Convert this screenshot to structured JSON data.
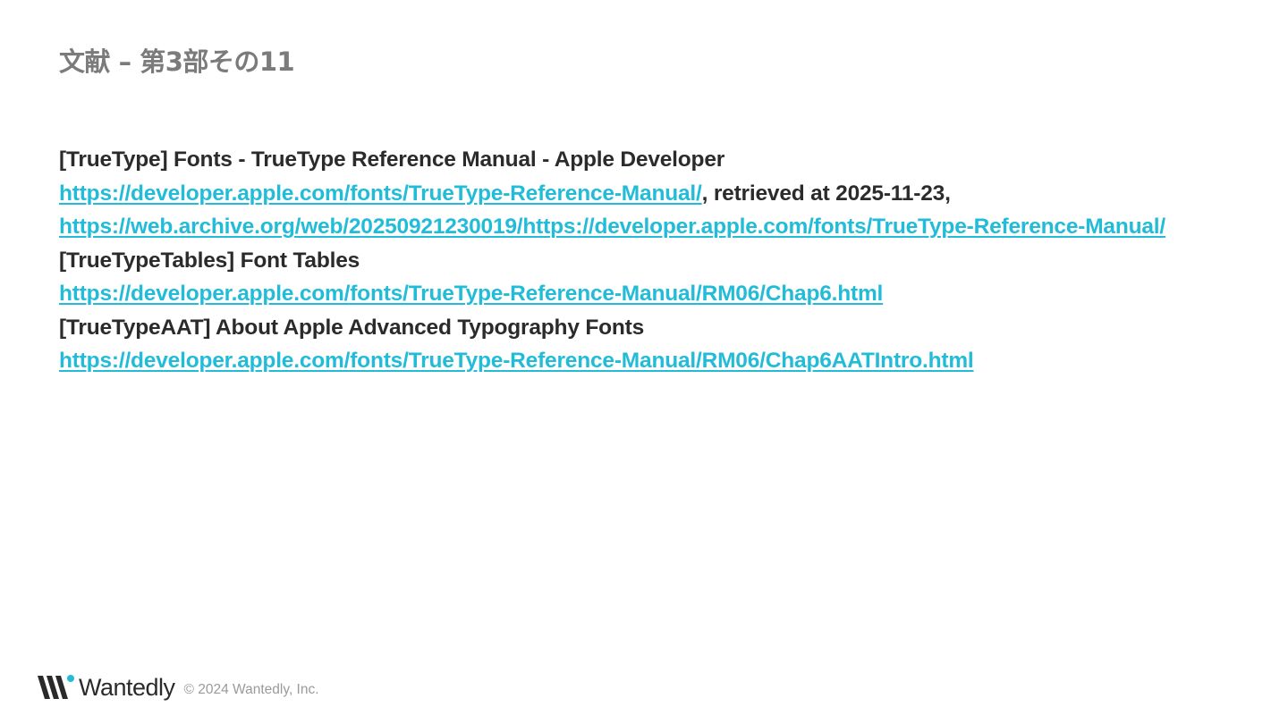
{
  "title": "文献 – 第3部その11",
  "references": {
    "ref1": {
      "heading": "[TrueType] Fonts - TrueType Reference Manual - Apple Developer",
      "url": "https://developer.apple.com/fonts/TrueType-Reference-Manual/",
      "retrieved_note": ", retrieved at 2025-11-23,",
      "archive_url": "https://web.archive.org/web/20250921230019/https://developer.apple.com/fonts/TrueType-Reference-Manual/"
    },
    "ref2": {
      "heading": "[TrueTypeTables] Font Tables",
      "url": "https://developer.apple.com/fonts/TrueType-Reference-Manual/RM06/Chap6.html"
    },
    "ref3": {
      "heading": "[TrueTypeAAT] About Apple Advanced Typography Fonts",
      "url": "https://developer.apple.com/fonts/TrueType-Reference-Manual/RM06/Chap6AATIntro.html"
    }
  },
  "footer": {
    "logo_text": "Wantedly",
    "logo_icon": "wantedly-logo-icon",
    "copyright": "© 2024 Wantedly, Inc."
  },
  "colors": {
    "title": "#7b7b7b",
    "text": "#2b2b2b",
    "link": "#22bcd9",
    "logo_accent": "#22bcd9"
  }
}
